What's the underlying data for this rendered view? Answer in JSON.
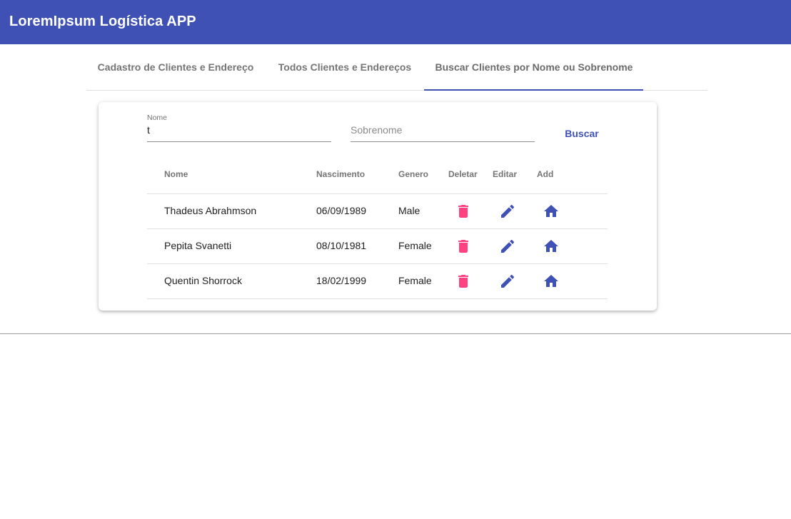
{
  "app": {
    "title": "LoremIpsum Logística APP",
    "brand_color": "#3f51b5"
  },
  "tabs": [
    {
      "label": "Cadastro de Clientes e Endereço",
      "active": false
    },
    {
      "label": "Todos Clientes e Endereços",
      "active": false
    },
    {
      "label": "Buscar Clientes por Nome ou Sobrenome",
      "active": true
    }
  ],
  "search": {
    "nome_label": "Nome",
    "nome_value": "t",
    "sobrenome_placeholder": "Sobrenome",
    "sobrenome_value": "",
    "buscar_label": "Buscar"
  },
  "table": {
    "columns": [
      "Nome",
      "Nascimento",
      "Genero",
      "Deletar",
      "Editar",
      "Add"
    ],
    "rows": [
      {
        "nome": "Thadeus Abrahmson",
        "nascimento": "06/09/1989",
        "genero": "Male"
      },
      {
        "nome": "Pepita Svanetti",
        "nascimento": "08/10/1981",
        "genero": "Female"
      },
      {
        "nome": "Quentin Shorrock",
        "nascimento": "18/02/1999",
        "genero": "Female"
      }
    ],
    "icons": {
      "delete": "delete-icon",
      "edit": "edit-icon",
      "add": "home-icon"
    },
    "colors": {
      "delete": "#ff4081",
      "edit": "#3f51b5",
      "add": "#3f51b5"
    }
  }
}
